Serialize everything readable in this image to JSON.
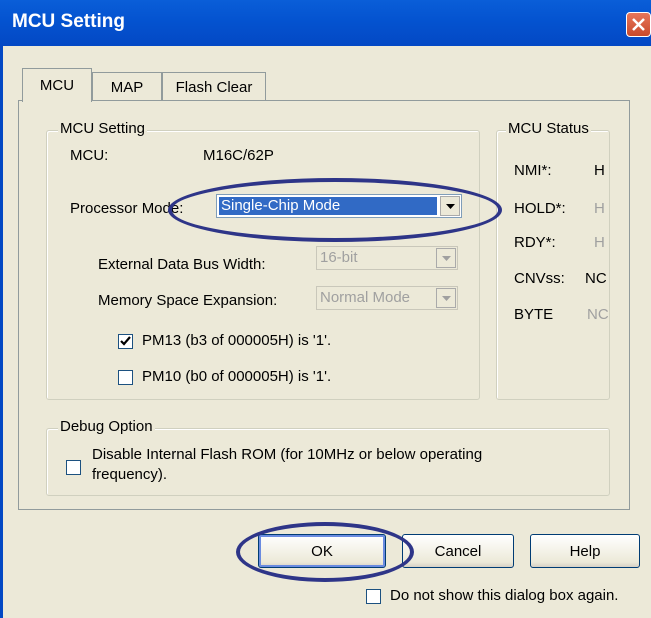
{
  "window": {
    "title": "MCU Setting"
  },
  "tabs": [
    {
      "label": "MCU",
      "active": true
    },
    {
      "label": "MAP",
      "active": false
    },
    {
      "label": "Flash Clear",
      "active": false
    }
  ],
  "mcu_setting": {
    "legend": "MCU Setting",
    "mcu_label": "MCU:",
    "mcu_value": "M16C/62P",
    "processor_mode_label": "Processor Mode:",
    "processor_mode_value": "Single-Chip Mode",
    "bus_width_label": "External Data Bus Width:",
    "bus_width_value": "16-bit",
    "memory_expansion_label": "Memory Space Expansion:",
    "memory_expansion_value": "Normal Mode",
    "pm13_label": "PM13 (b3 of 000005H) is '1'.",
    "pm13_checked": true,
    "pm10_label": "PM10 (b0 of 000005H) is '1'.",
    "pm10_checked": false
  },
  "mcu_status": {
    "legend": "MCU Status",
    "rows": [
      {
        "name": "NMI*:",
        "value": "H",
        "enabled": true
      },
      {
        "name": "HOLD*:",
        "value": "H",
        "enabled": false
      },
      {
        "name": "RDY*:",
        "value": "H",
        "enabled": false
      },
      {
        "name": "CNVss:",
        "value": "NC",
        "enabled": true
      },
      {
        "name": "BYTE",
        "value": "NC",
        "enabled": false
      }
    ]
  },
  "debug_option": {
    "legend": "Debug Option",
    "disable_flash_label_1": "Disable Internal Flash ROM (for 10MHz or below operating",
    "disable_flash_label_2": "frequency).",
    "disable_flash_checked": false
  },
  "buttons": {
    "ok": "OK",
    "cancel": "Cancel",
    "help": "Help"
  },
  "footer": {
    "dont_show_label": "Do not show this dialog box again.",
    "dont_show_checked": false
  },
  "colors": {
    "titlebar": "#0453d0",
    "dialog_bg": "#ece9d8",
    "highlight": "#316ac5",
    "annotation": "#2e3588"
  }
}
